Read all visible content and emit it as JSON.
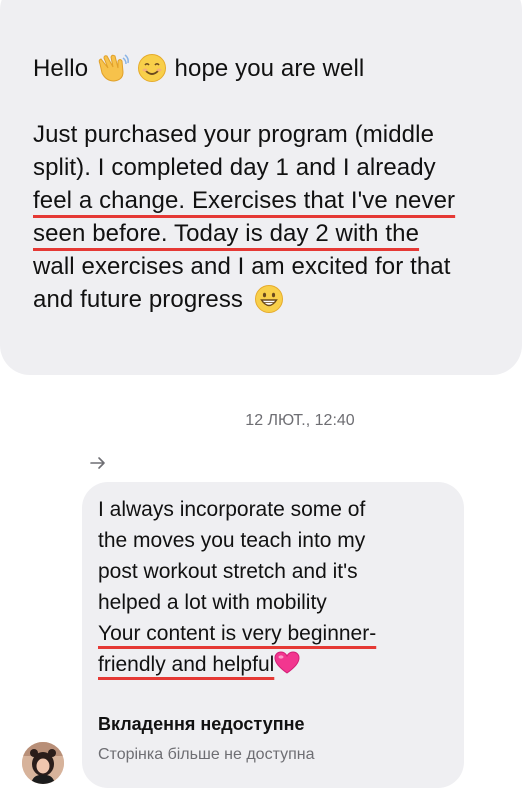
{
  "message1": {
    "greeting": "Hello",
    "greeting_tail": "hope you are well",
    "emojis": [
      "waving-hand",
      "smiling-face",
      "grinning-face"
    ],
    "lines": [
      "Just purchased your program  (middle",
      "split). I completed day 1 and I already",
      "feel a change. Exercises that I've never",
      "seen before. Today is day 2 with the",
      "wall exercises and I am excited for that",
      "and future progress"
    ]
  },
  "timestamp": "12 ЛЮТ., 12:40",
  "forward_icon": "arrow-right-icon",
  "message2": {
    "lines": [
      "I always incorporate some of",
      "the moves you teach into my",
      "post workout stretch and it's",
      "helped a lot with mobility",
      "Your content is very beginner-",
      "friendly and helpful"
    ],
    "emoji": "pink-heart"
  },
  "attachment": {
    "title": "Вкладення недоступне",
    "subtitle": "Сторінка більше не доступна"
  },
  "colors": {
    "bubble": "#efeff2",
    "underline": "#e53935",
    "muted_text": "#6e6e73"
  }
}
